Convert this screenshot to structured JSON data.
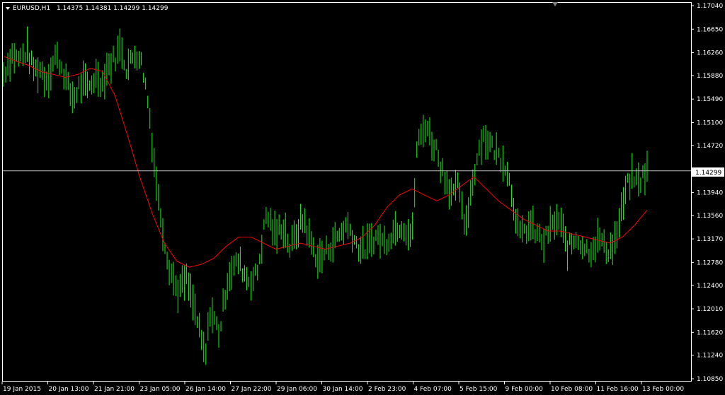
{
  "header": {
    "symbol": "EURUSD,H1",
    "ohlc": "1.14375 1.14381 1.14299 1.14299"
  },
  "price_axis": {
    "ticks": [
      "1.17040",
      "1.16650",
      "1.16260",
      "1.15880",
      "1.15490",
      "1.15100",
      "1.14720",
      "1.13940",
      "1.13560",
      "1.13170",
      "1.12780",
      "1.12400",
      "1.12010",
      "1.11620",
      "1.11240",
      "1.10850"
    ],
    "current_price_label": "1.14299"
  },
  "time_axis": {
    "ticks": [
      "19 Jan 2015",
      "20 Jan 13:00",
      "21 Jan 21:00",
      "23 Jan 05:00",
      "26 Jan 14:00",
      "27 Jan 22:00",
      "29 Jan 06:00",
      "30 Jan 14:00",
      "2 Feb 23:00",
      "4 Feb 07:00",
      "5 Feb 15:00",
      "9 Feb 00:00",
      "10 Feb 08:00",
      "11 Feb 16:00",
      "13 Feb 00:00"
    ]
  },
  "colors": {
    "background": "#000000",
    "bars": "#00ff00",
    "moving_average": "#ff0000",
    "axis": "#ffffff",
    "price_line": "#c0c0c0"
  },
  "chart_data": {
    "type": "line",
    "title": "EURUSD,H1",
    "ylim": [
      1.1085,
      1.1704
    ],
    "current_price": 1.14299,
    "bar_series": {
      "name": "EURUSD H1",
      "x_start": "19 Jan 2015",
      "closes": [
        1.159,
        1.161,
        1.1625,
        1.1615,
        1.162,
        1.163,
        1.1605,
        1.1595,
        1.16,
        1.158,
        1.1595,
        1.162,
        1.161,
        1.159,
        1.156,
        1.155,
        1.157,
        1.1575,
        1.1565,
        1.158,
        1.159,
        1.1575,
        1.16,
        1.161,
        1.162,
        1.164,
        1.16,
        1.161,
        1.1625,
        1.162,
        1.1585,
        1.153,
        1.145,
        1.138,
        1.133,
        1.128,
        1.1255,
        1.123,
        1.124,
        1.125,
        1.122,
        1.119,
        1.115,
        1.112,
        1.12,
        1.118,
        1.116,
        1.122,
        1.126,
        1.127,
        1.128,
        1.1265,
        1.125,
        1.125,
        1.126,
        1.131,
        1.136,
        1.134,
        1.132,
        1.134,
        1.133,
        1.13,
        1.132,
        1.134,
        1.135,
        1.132,
        1.13,
        1.128,
        1.129,
        1.13,
        1.131,
        1.132,
        1.133,
        1.134,
        1.133,
        1.131,
        1.13,
        1.13,
        1.131,
        1.132,
        1.132,
        1.131,
        1.132,
        1.133,
        1.134,
        1.134,
        1.133,
        1.132,
        1.147,
        1.149,
        1.151,
        1.148,
        1.147,
        1.144,
        1.142,
        1.14,
        1.139,
        1.141,
        1.133,
        1.137,
        1.142,
        1.146,
        1.149,
        1.148,
        1.147,
        1.146,
        1.145,
        1.144,
        1.14,
        1.136,
        1.132,
        1.133,
        1.134,
        1.133,
        1.132,
        1.131,
        1.133,
        1.134,
        1.135,
        1.133,
        1.13,
        1.131,
        1.132,
        1.131,
        1.13,
        1.13,
        1.131,
        1.132,
        1.13,
        1.13,
        1.131,
        1.134,
        1.138,
        1.141,
        1.142,
        1.141,
        1.142,
        1.143
      ],
      "x_end": "13 Feb 00:00"
    },
    "moving_average": {
      "name": "MA",
      "values": [
        1.162,
        1.1612,
        1.1605,
        1.1595,
        1.159,
        1.1585,
        1.159,
        1.16,
        1.1595,
        1.1555,
        1.149,
        1.142,
        1.136,
        1.131,
        1.128,
        1.127,
        1.1275,
        1.1285,
        1.1305,
        1.132,
        1.132,
        1.131,
        1.13,
        1.1305,
        1.131,
        1.1305,
        1.13,
        1.1305,
        1.131,
        1.132,
        1.134,
        1.137,
        1.139,
        1.14,
        1.139,
        1.138,
        1.139,
        1.1405,
        1.142,
        1.14,
        1.138,
        1.1365,
        1.135,
        1.134,
        1.133,
        1.133,
        1.1325,
        1.132,
        1.1315,
        1.131,
        1.132,
        1.134,
        1.1365
      ]
    }
  }
}
